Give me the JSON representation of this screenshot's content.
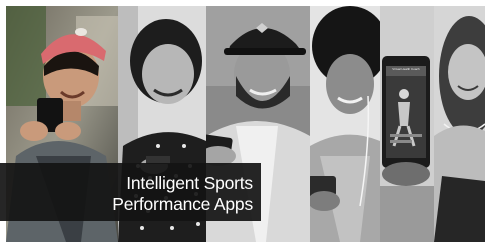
{
  "caption": {
    "line1": "Intelligent Sports",
    "line2": "Performance Apps"
  },
  "phone_screen": {
    "header_text": "Virtual Health Coach"
  },
  "colors": {
    "accent_cap": "#d96a6f",
    "caption_bg": "#141414",
    "caption_text": "#ffffff"
  }
}
